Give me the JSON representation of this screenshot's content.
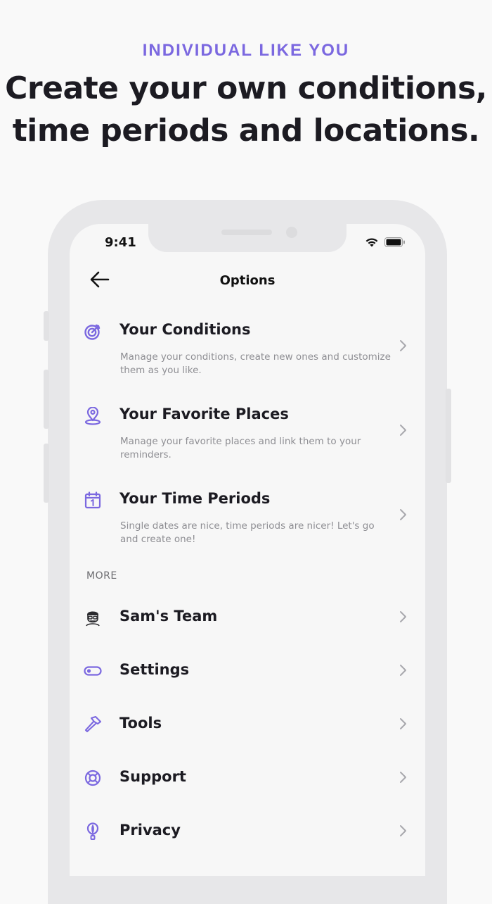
{
  "page": {
    "eyebrow": "INDIVIDUAL LIKE YOU",
    "headline_line1": "Create your own conditions,",
    "headline_line2": "time periods and locations."
  },
  "status_bar": {
    "time": "9:41"
  },
  "nav": {
    "title": "Options",
    "back_icon": "arrow-left-icon"
  },
  "main_items": [
    {
      "icon": "target-icon",
      "title": "Your Conditions",
      "description": "Manage your conditions, create new ones and customize them as you like."
    },
    {
      "icon": "location-pin-icon",
      "title": "Your Favorite Places",
      "description": "Manage your favorite places and link them to your reminders."
    },
    {
      "icon": "calendar-icon",
      "title": "Your Time Periods",
      "description": "Single dates are nice, time periods are nicer! Let's go and create one!"
    }
  ],
  "more": {
    "label": "MORE",
    "items": [
      {
        "icon": "team-avatar-icon",
        "title": "Sam's Team"
      },
      {
        "icon": "toggle-icon",
        "title": "Settings"
      },
      {
        "icon": "hammer-icon",
        "title": "Tools"
      },
      {
        "icon": "lifebuoy-icon",
        "title": "Support"
      },
      {
        "icon": "balloon-icon",
        "title": "Privacy"
      }
    ]
  },
  "colors": {
    "accent": "#7b68e0",
    "text": "#1c1b22",
    "muted": "#8e8e93",
    "frame": "#e7e7e9",
    "screen": "#f7f7f7"
  }
}
